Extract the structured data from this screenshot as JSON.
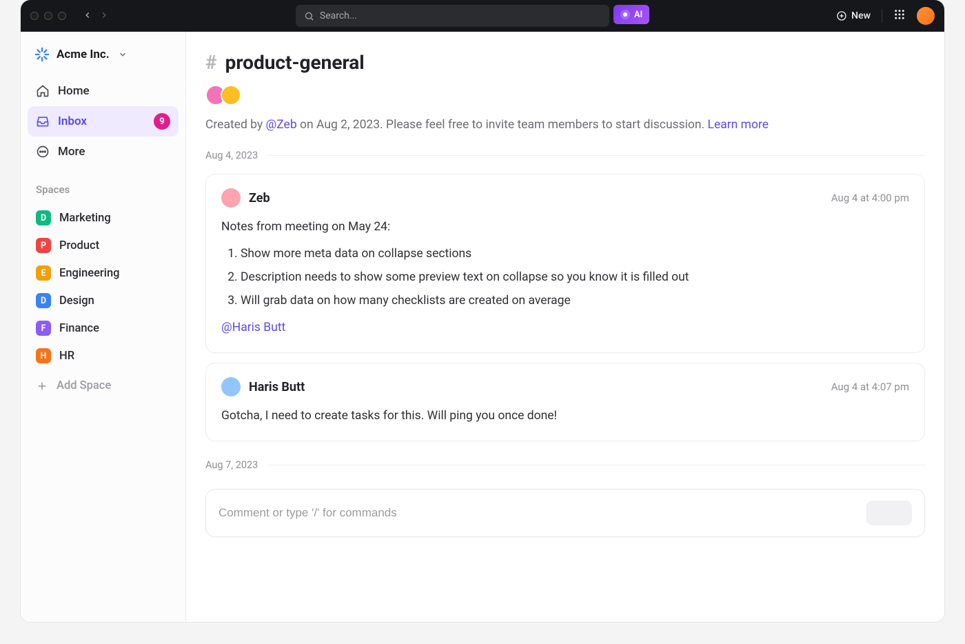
{
  "titlebar": {
    "search_placeholder": "Search...",
    "ai_label": "AI",
    "new_label": "New"
  },
  "sidebar": {
    "workspace_name": "Acme Inc.",
    "nav": {
      "home": "Home",
      "inbox": "Inbox",
      "inbox_badge": "9",
      "more": "More"
    },
    "spaces_label": "Spaces",
    "spaces": [
      {
        "letter": "D",
        "name": "Marketing",
        "color": "#10b981"
      },
      {
        "letter": "P",
        "name": "Product",
        "color": "#ef4444"
      },
      {
        "letter": "E",
        "name": "Engineering",
        "color": "#f59e0b"
      },
      {
        "letter": "D",
        "name": "Design",
        "color": "#3b82f6"
      },
      {
        "letter": "F",
        "name": "Finance",
        "color": "#8b5cf6"
      },
      {
        "letter": "H",
        "name": "HR",
        "color": "#f97316"
      }
    ],
    "add_space": "Add Space"
  },
  "channel": {
    "name": "product-general",
    "created_prefix": "Created by ",
    "created_by": "@Zeb",
    "created_mid": " on Aug 2, 2023. Please feel free to invite team members to start discussion. ",
    "learn_more": "Learn more",
    "members": [
      {
        "bg": "#f472b6"
      },
      {
        "bg": "#fbbf24"
      }
    ]
  },
  "dates": {
    "d1": "Aug 4, 2023",
    "d2": "Aug 7, 2023"
  },
  "messages": [
    {
      "author": "Zeb",
      "avatar_bg": "#fda4af",
      "timestamp": "Aug 4 at 4:00 pm",
      "lead": "Notes from meeting on May 24:",
      "items": [
        "Show more meta data on collapse sections",
        "Description needs to show some preview text on collapse so you know it is filled out",
        "Will grab data on how many checklists are created on average"
      ],
      "mention": "@Haris Butt"
    },
    {
      "author": "Haris Butt",
      "avatar_bg": "#93c5fd",
      "timestamp": "Aug 4 at 4:07 pm",
      "text": "Gotcha, I need to create tasks for this. Will ping you once done!"
    }
  ],
  "composer": {
    "placeholder": "Comment or type '/' for commands"
  }
}
